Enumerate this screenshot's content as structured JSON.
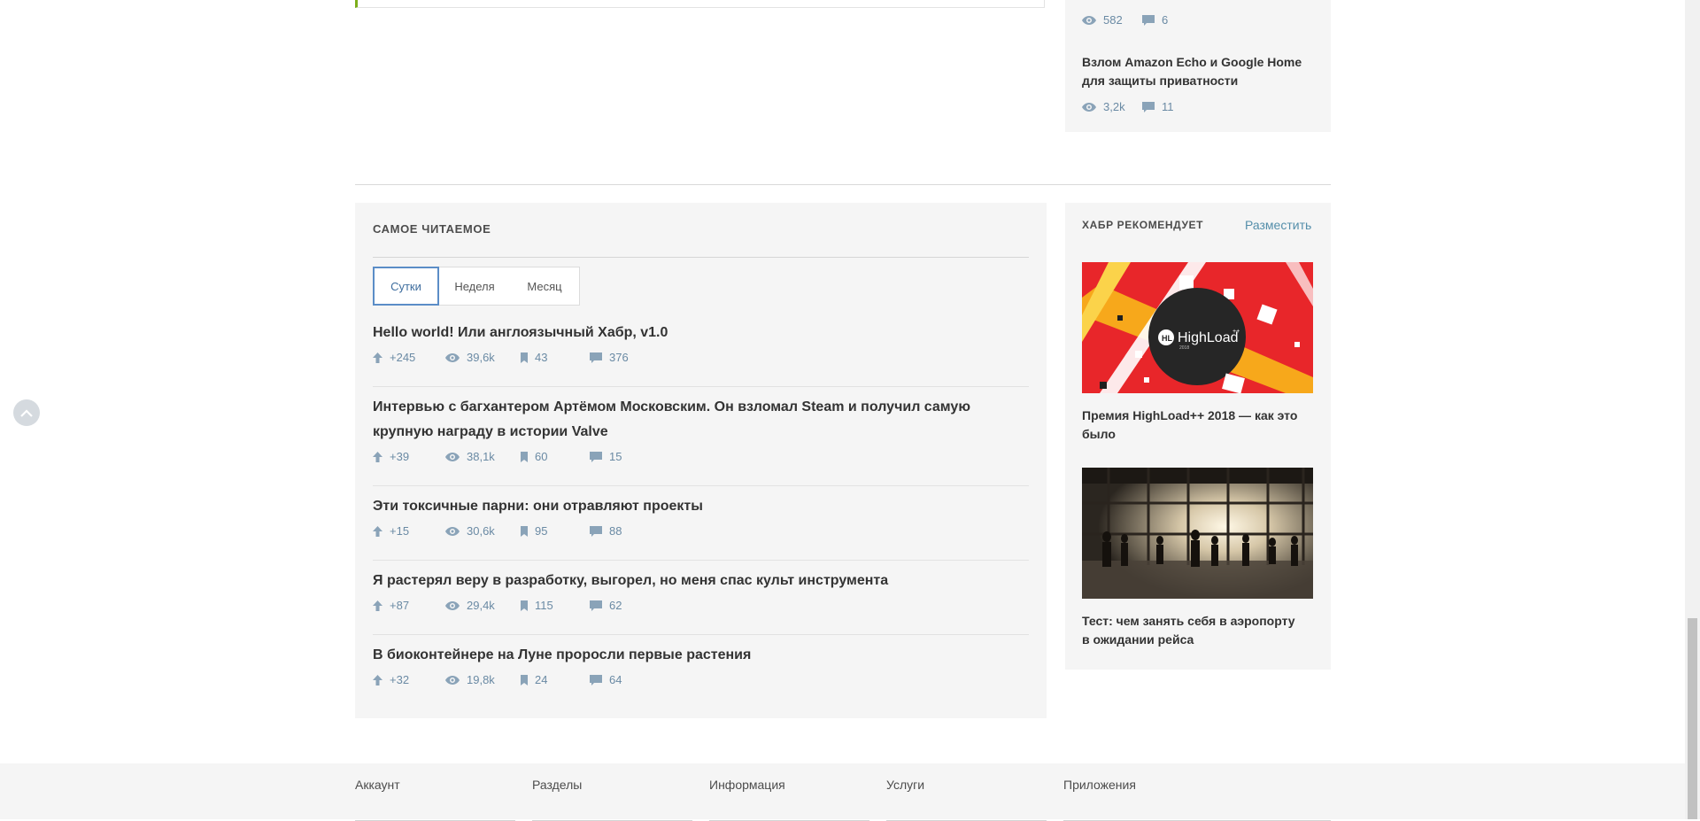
{
  "side_top": {
    "item1": {
      "views": "582",
      "comments": "6"
    },
    "item2": {
      "title": "Взлом Amazon Echo и Google Home для защиты приватности",
      "views": "3,2k",
      "comments": "11"
    }
  },
  "most_read": {
    "title": "САМОЕ ЧИТАЕМОЕ",
    "tabs": [
      "Сутки",
      "Неделя",
      "Месяц"
    ],
    "active_tab": "Сутки",
    "posts": [
      {
        "title": "Hello world! Или англоязычный Хабр, v1.0",
        "rating": "+245",
        "views": "39,6k",
        "bookmarks": "43",
        "comments": "376"
      },
      {
        "title": "Интервью с багхантером Артёмом Московским. Он взломал Steam и получил самую крупную награду в истории Valve",
        "rating": "+39",
        "views": "38,1k",
        "bookmarks": "60",
        "comments": "15"
      },
      {
        "title": "Эти токсичные парни: они отравляют проекты",
        "rating": "+15",
        "views": "30,6k",
        "bookmarks": "95",
        "comments": "88"
      },
      {
        "title": "Я растерял веру в разработку, выгорел, но меня спас культ инструмента",
        "rating": "+87",
        "views": "29,4k",
        "bookmarks": "115",
        "comments": "62"
      },
      {
        "title": "В биоконтейнере на Луне проросли первые растения",
        "rating": "+32",
        "views": "19,8k",
        "bookmarks": "24",
        "comments": "64"
      }
    ]
  },
  "recommend": {
    "title": "ХАБР РЕКОМЕНДУЕТ",
    "place_link": "Разместить",
    "items": [
      {
        "title": "Премия HighLoad++ 2018 — как это было",
        "logo_text": "HighLoad",
        "logo_sup": "++",
        "logo_mark": "HL",
        "logo_year": "2018"
      },
      {
        "title": "Тест: чем занять себя в аэропорту в ожидании рейса"
      }
    ]
  },
  "footer": {
    "columns": [
      "Аккаунт",
      "Разделы",
      "Информация",
      "Услуги",
      "Приложения"
    ]
  },
  "colors": {
    "accent_blue": "#548eaa",
    "meta": "#6a8aa4",
    "green_border": "#7cae1a",
    "promo_red": "#e8262a"
  }
}
